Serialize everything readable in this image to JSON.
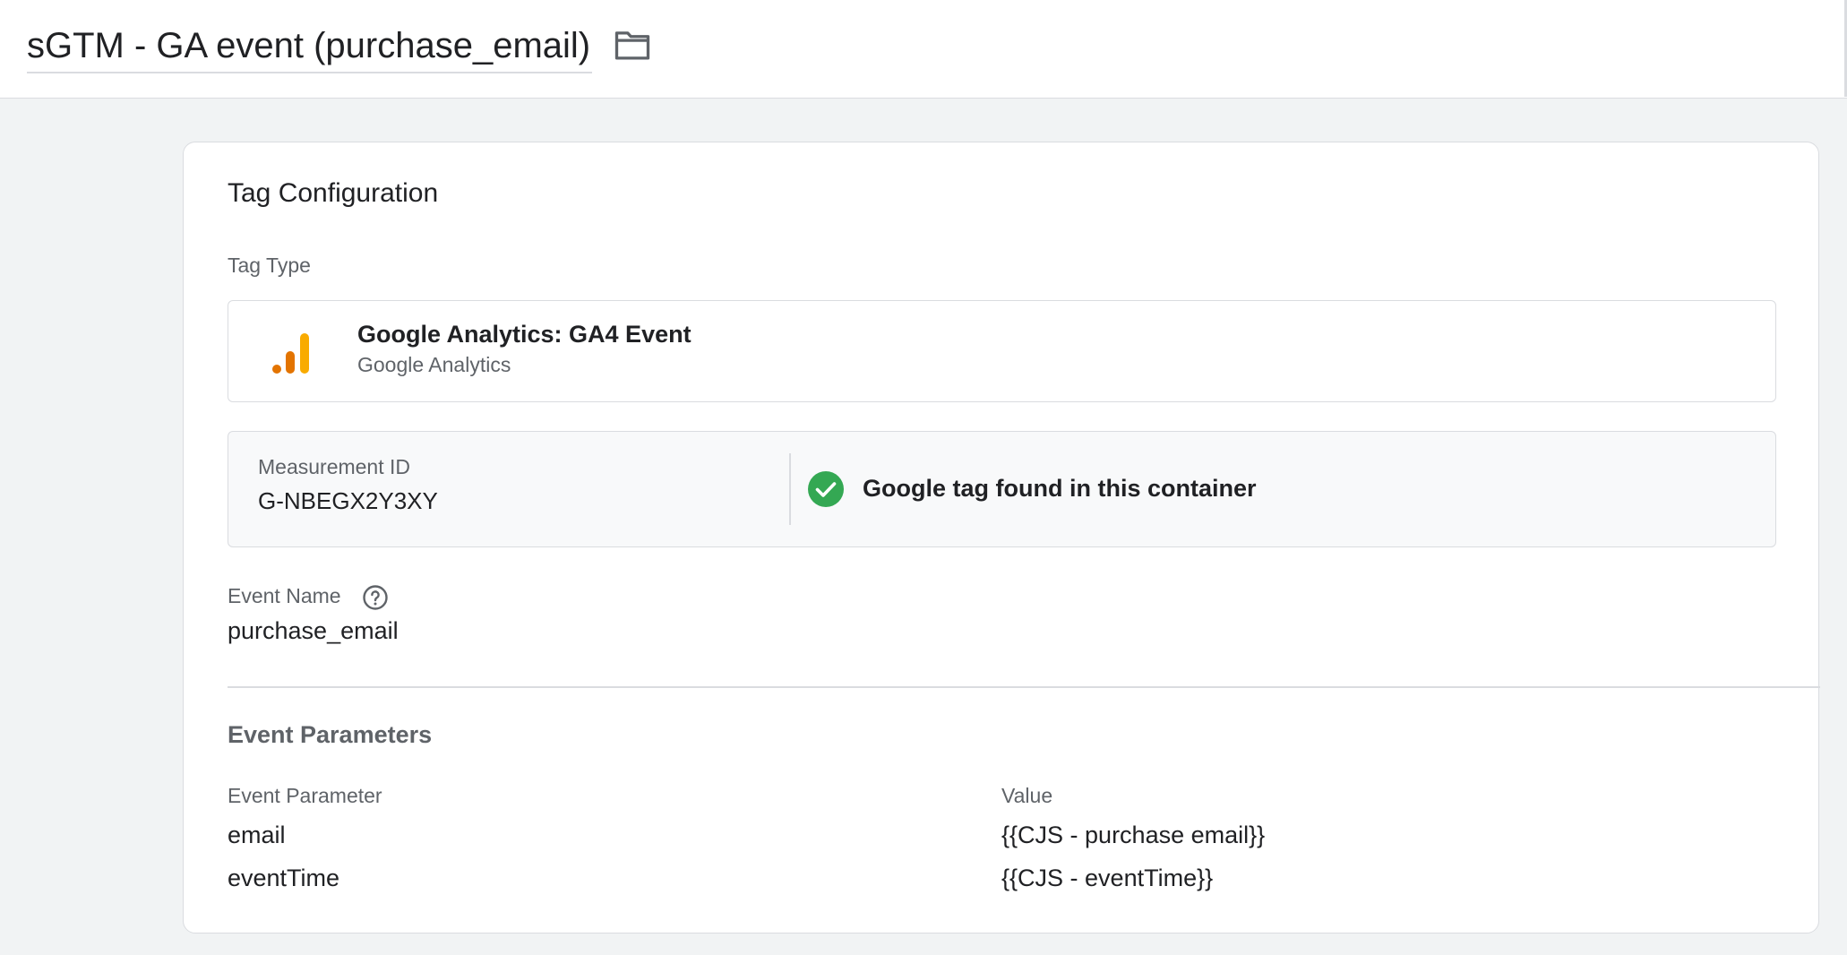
{
  "header": {
    "tag_name": "sGTM - GA event (purchase_email)",
    "folder_icon": "folder-icon"
  },
  "card": {
    "title": "Tag Configuration",
    "tag_type_label": "Tag Type",
    "tag_type": {
      "name": "Google Analytics: GA4 Event",
      "vendor": "Google Analytics",
      "icon": "google-analytics-icon",
      "icon_colors": [
        "#e37400",
        "#f9ab00"
      ]
    },
    "measurement": {
      "label": "Measurement ID",
      "value": "G-NBEGX2Y3XY",
      "status_text": "Google tag found in this container",
      "status_icon": "check-circle-icon",
      "status_color": "#34a853"
    },
    "event_name": {
      "label": "Event Name",
      "value": "purchase_email",
      "help_icon": "help-icon"
    },
    "event_parameters": {
      "title": "Event Parameters",
      "columns": [
        "Event Parameter",
        "Value"
      ],
      "rows": [
        {
          "parameter": "email",
          "value": "{{CJS - purchase email}}"
        },
        {
          "parameter": "eventTime",
          "value": "{{CJS - eventTime}}"
        }
      ]
    }
  }
}
